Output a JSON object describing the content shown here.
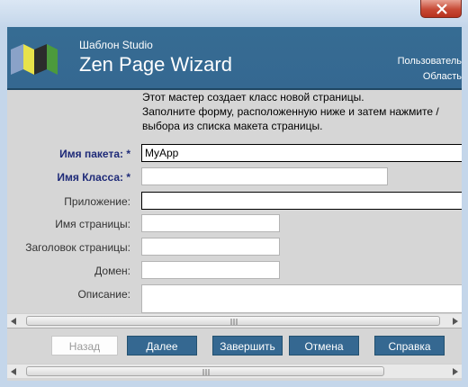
{
  "header": {
    "subtitle": "Шаблон Studio",
    "title": "Zen Page Wizard",
    "right_line1": "Пользователь",
    "right_line2": "Область"
  },
  "intro": {
    "line1": "Этот мастер создает класс новой страницы.",
    "line2": "Заполните форму, расположенную ниже и затем нажмите /",
    "line3": "выбора из списка макета страницы."
  },
  "form": {
    "package_label": "Имя пакета: *",
    "package_value": "MyApp",
    "class_label": "Имя Класса: *",
    "class_value": "",
    "application_label": "Приложение:",
    "application_value": "",
    "page_name_label": "Имя страницы:",
    "page_name_value": "",
    "page_title_label": "Заголовок страницы:",
    "page_title_value": "",
    "domain_label": "Домен:",
    "domain_value": "",
    "description_label": "Описание:",
    "description_value": ""
  },
  "buttons": {
    "back": "Назад",
    "next": "Далее",
    "finish": "Завершить",
    "cancel": "Отмена",
    "help": "Справка"
  },
  "colors": {
    "header_bg": "#366c93",
    "button_bg": "#356891",
    "required_label": "#1e2a78"
  }
}
